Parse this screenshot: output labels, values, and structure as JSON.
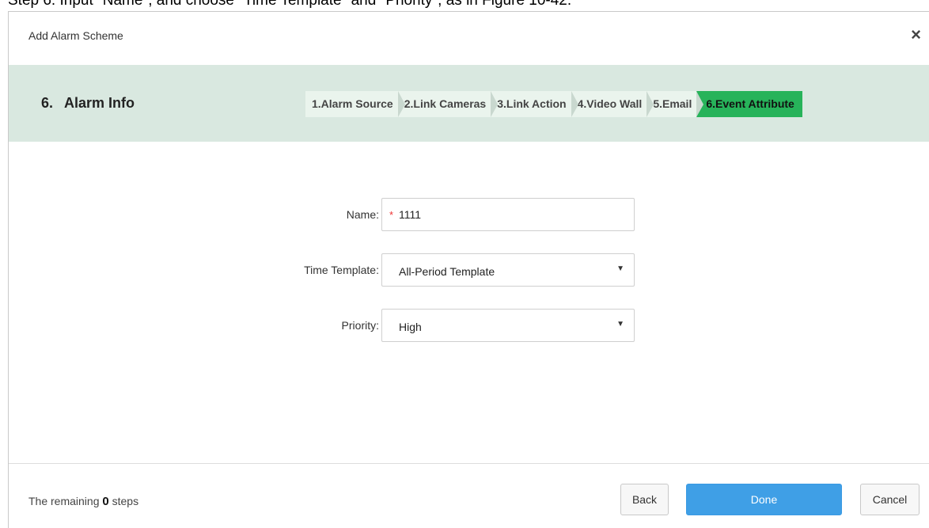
{
  "document": {
    "caption": "Step 6.  Input \"Name\", and choose \"Time Template\" and \"Priority\", as in Figure 10-42."
  },
  "dialog": {
    "title": "Add Alarm Scheme",
    "close_glyph": "×"
  },
  "header": {
    "step_number": "6.",
    "step_title": "Alarm Info"
  },
  "stepper": {
    "steps": [
      {
        "label": "1.Alarm Source"
      },
      {
        "label": "2.Link Cameras"
      },
      {
        "label": "3.Link Action"
      },
      {
        "label": "4.Video Wall"
      },
      {
        "label": "5.Email"
      },
      {
        "label": "6.Event Attribute"
      }
    ],
    "active_index": 5,
    "active_color": "#27b35a"
  },
  "form": {
    "name": {
      "label": "Name:",
      "required_mark": "*",
      "value": "1111"
    },
    "time_template": {
      "label": "Time Template:",
      "value": "All-Period Template",
      "caret": "▼"
    },
    "priority": {
      "label": "Priority:",
      "value": "High",
      "caret": "▼"
    }
  },
  "footer": {
    "remaining_prefix": "The remaining",
    "remaining_count": "0",
    "remaining_suffix": "steps",
    "back_label": "Back",
    "done_label": "Done",
    "cancel_label": "Cancel"
  },
  "colors": {
    "header_band": "#d9e8e0",
    "done_button": "#3f9fe6",
    "required": "#e33333"
  }
}
